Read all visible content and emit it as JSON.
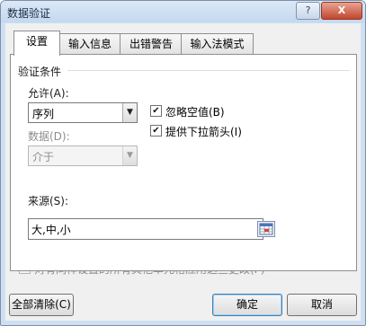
{
  "window": {
    "title": "数据验证",
    "help_label": "?",
    "close_label": "X"
  },
  "tabs": [
    {
      "label": "设置",
      "active": true
    },
    {
      "label": "输入信息",
      "active": false
    },
    {
      "label": "出错警告",
      "active": false
    },
    {
      "label": "输入法模式",
      "active": false
    }
  ],
  "settings": {
    "section_title": "验证条件",
    "allow": {
      "label": "允许(A):",
      "value": "序列"
    },
    "ignore_blank": {
      "label": "忽略空值(B)",
      "checked": true
    },
    "in_cell_dropdown": {
      "label": "提供下拉箭头(I)",
      "checked": true
    },
    "data": {
      "label": "数据(D):",
      "value": "介于",
      "disabled": true
    },
    "source": {
      "label": "来源(S):",
      "value": "大,中,小"
    }
  },
  "apply_all": {
    "label": "对有同样设置的所有其他单元格应用这些更改(P)",
    "checked": false,
    "disabled": true
  },
  "buttons": {
    "clear_all": "全部清除(C)",
    "ok": "确定",
    "cancel": "取消"
  },
  "colors": {
    "title_bar": "#c5d8ef",
    "close_button": "#c3462d",
    "dialog_background": "#f0f0f0",
    "default_button_border": "#3c7fb1"
  }
}
